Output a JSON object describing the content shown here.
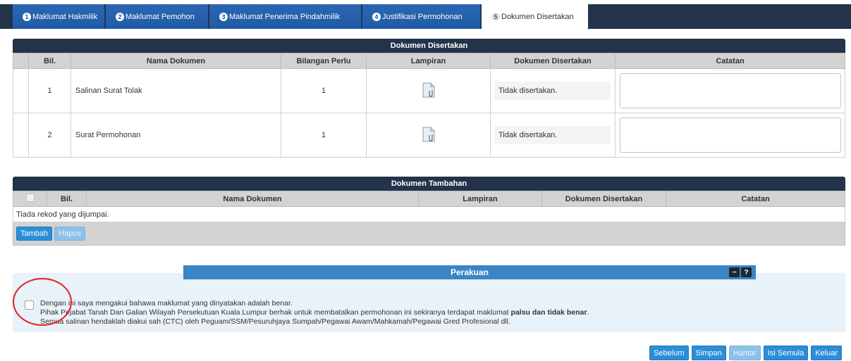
{
  "tabs": [
    {
      "num": "1",
      "label": "Maklumat Hakmilik"
    },
    {
      "num": "2",
      "label": "Maklumat Pemohon"
    },
    {
      "num": "3",
      "label": "Maklumat Penerima Pindahmilik"
    },
    {
      "num": "4",
      "label": "Justifikasi Permohonan"
    },
    {
      "num": "5",
      "label": "Dokumen Disertakan"
    }
  ],
  "dokumen": {
    "title": "Dokumen Disertakan",
    "headers": {
      "bil": "Bil.",
      "nama": "Nama Dokumen",
      "bilangan": "Bilangan Perlu",
      "lampiran": "Lampiran",
      "disertakan": "Dokumen Disertakan",
      "catatan": "Catatan"
    },
    "rows": [
      {
        "bil": "1",
        "nama": "Salinan Surat Tolak",
        "bilangan": "1",
        "status": "Tidak disertakan.",
        "catatan": ""
      },
      {
        "bil": "2",
        "nama": "Surat Permohonan",
        "bilangan": "1",
        "status": "Tidak disertakan.",
        "catatan": ""
      }
    ]
  },
  "tambahan": {
    "title": "Dokumen Tambahan",
    "headers": {
      "bil": "Bil.",
      "nama": "Nama Dokumen",
      "lampiran": "Lampiran",
      "disertakan": "Dokumen Disertakan",
      "catatan": "Catatan"
    },
    "empty_message": "Tiada rekod yang dijumpai.",
    "add_label": "Tambah",
    "delete_label": "Hapus"
  },
  "perakuan": {
    "title": "Perakuan",
    "minimize_label": "−",
    "help_label": "?",
    "line1": "Dengan ini saya mengakui bahawa maklumat yang dinyatakan adalah benar.",
    "line2_prefix": "Pihak Pejabat Tanah Dan Galian Wilayah Persekutuan Kuala Lumpur berhak untuk membatalkan permohonan ini sekiranya terdapat maklumat ",
    "line2_bold": "palsu dan tidak benar",
    "line2_suffix": ".",
    "line3": "Semua salinan hendaklah diakui sah (CTC) oleh Peguam/SSM/Pesuruhjaya Sumpah/Pegawai Awam/Mahkamah/Pegawai Gred Profesional dll."
  },
  "actions": {
    "sebelum": "Sebelum",
    "simpan": "Simpan",
    "hantar": "Hantar",
    "isi_semula": "Isi Semula",
    "keluar": "Keluar"
  },
  "colors": {
    "header_dark": "#22334a",
    "tab_blue": "#1f5aa6",
    "button_blue": "#2a8ed8",
    "annotation_red": "#e02020"
  }
}
